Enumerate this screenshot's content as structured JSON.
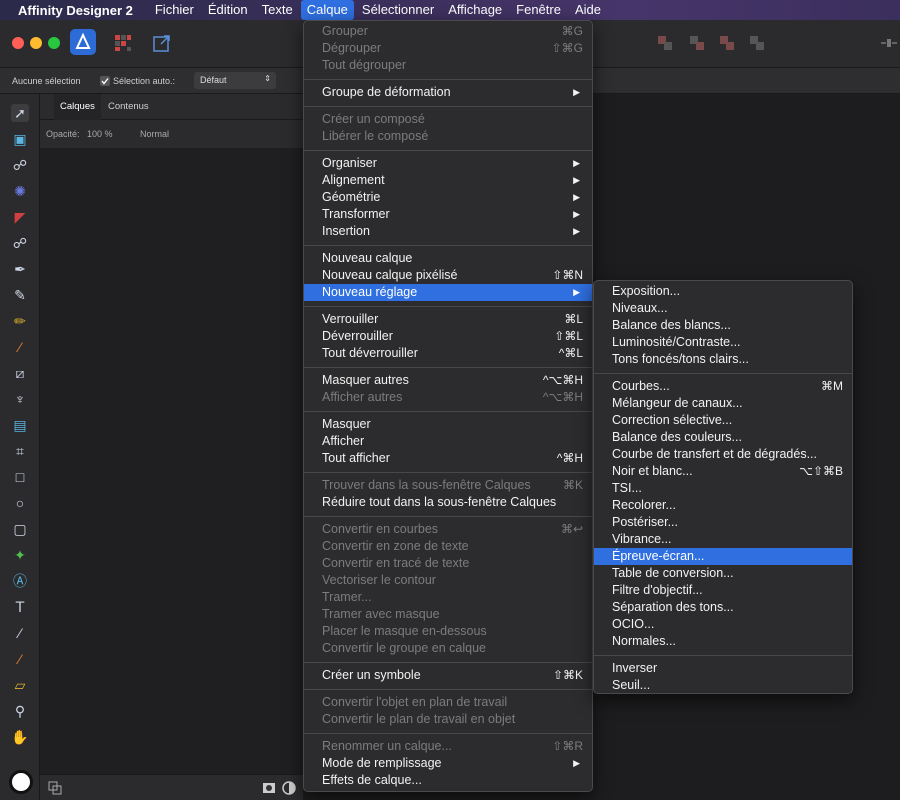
{
  "menubar": {
    "app": "Affinity Designer 2",
    "items": [
      "Fichier",
      "Édition",
      "Texte",
      "Calque",
      "Sélectionner",
      "Affichage",
      "Fenêtre",
      "Aide"
    ],
    "active_index": 3
  },
  "contextbar": {
    "no_selection": "Aucune sélection",
    "auto_select": "Sélection auto.:",
    "default_value": "Défaut"
  },
  "layers_panel": {
    "tabs": [
      "Calques",
      "Contenus"
    ],
    "opacity_label": "Opacité:",
    "opacity_value": "100 %",
    "blend_mode": "Normal"
  },
  "calque_menu": {
    "groups": [
      [
        {
          "label": "Grouper",
          "shortcut": "⌘G",
          "disabled": true
        },
        {
          "label": "Dégrouper",
          "shortcut": "⇧⌘G",
          "disabled": true
        },
        {
          "label": "Tout dégrouper",
          "shortcut": "",
          "disabled": true
        }
      ],
      [
        {
          "label": "Groupe de déformation",
          "submenu": true
        }
      ],
      [
        {
          "label": "Créer un composé",
          "disabled": true
        },
        {
          "label": "Libérer le composé",
          "disabled": true
        }
      ],
      [
        {
          "label": "Organiser",
          "submenu": true
        },
        {
          "label": "Alignement",
          "submenu": true
        },
        {
          "label": "Géométrie",
          "submenu": true
        },
        {
          "label": "Transformer",
          "submenu": true
        },
        {
          "label": "Insertion",
          "submenu": true
        }
      ],
      [
        {
          "label": "Nouveau calque"
        },
        {
          "label": "Nouveau calque pixélisé",
          "shortcut": "⇧⌘N"
        },
        {
          "label": "Nouveau réglage",
          "submenu": true,
          "highlighted": true
        }
      ],
      [
        {
          "label": "Verrouiller",
          "shortcut": "⌘L"
        },
        {
          "label": "Déverrouiller",
          "shortcut": "⇧⌘L"
        },
        {
          "label": "Tout déverrouiller",
          "shortcut": "^⌘L"
        }
      ],
      [
        {
          "label": "Masquer autres",
          "shortcut": "^⌥⌘H"
        },
        {
          "label": "Afficher autres",
          "shortcut": "^⌥⌘H",
          "disabled": true
        }
      ],
      [
        {
          "label": "Masquer"
        },
        {
          "label": "Afficher"
        },
        {
          "label": "Tout afficher",
          "shortcut": "^⌘H"
        }
      ],
      [
        {
          "label": "Trouver dans la sous-fenêtre Calques",
          "shortcut": "⌘K",
          "disabled": true
        },
        {
          "label": "Réduire tout dans la sous-fenêtre Calques"
        }
      ],
      [
        {
          "label": "Convertir en courbes",
          "shortcut": "⌘↩",
          "disabled": true
        },
        {
          "label": "Convertir en zone de texte",
          "disabled": true
        },
        {
          "label": "Convertir en tracé de texte",
          "disabled": true
        },
        {
          "label": "Vectoriser le contour",
          "disabled": true
        },
        {
          "label": "Tramer...",
          "disabled": true
        },
        {
          "label": "Tramer avec masque",
          "disabled": true
        },
        {
          "label": "Placer le masque en-dessous",
          "disabled": true
        },
        {
          "label": "Convertir le groupe en calque",
          "disabled": true
        }
      ],
      [
        {
          "label": "Créer un symbole",
          "shortcut": "⇧⌘K"
        }
      ],
      [
        {
          "label": "Convertir l'objet en plan de travail",
          "disabled": true
        },
        {
          "label": "Convertir le plan de travail en objet",
          "disabled": true
        }
      ],
      [
        {
          "label": "Renommer un calque...",
          "shortcut": "⇧⌘R",
          "disabled": true
        },
        {
          "label": "Mode de remplissage",
          "submenu": true
        },
        {
          "label": "Effets de calque..."
        }
      ]
    ]
  },
  "reglage_submenu": {
    "groups": [
      [
        {
          "label": "Exposition..."
        },
        {
          "label": "Niveaux..."
        },
        {
          "label": "Balance des blancs..."
        },
        {
          "label": "Luminosité/Contraste..."
        },
        {
          "label": "Tons foncés/tons clairs..."
        }
      ],
      [
        {
          "label": "Courbes...",
          "shortcut": "⌘M"
        },
        {
          "label": "Mélangeur de canaux..."
        },
        {
          "label": "Correction sélective..."
        },
        {
          "label": "Balance des couleurs..."
        },
        {
          "label": "Courbe de transfert et de dégradés..."
        },
        {
          "label": "Noir et blanc...",
          "shortcut": "⌥⇧⌘B"
        },
        {
          "label": "TSI..."
        },
        {
          "label": "Recolorer..."
        },
        {
          "label": "Postériser..."
        },
        {
          "label": "Vibrance..."
        },
        {
          "label": "Épreuve-écran...",
          "highlighted": true
        },
        {
          "label": "Table de conversion..."
        },
        {
          "label": "Filtre d'objectif..."
        },
        {
          "label": "Séparation des tons..."
        },
        {
          "label": "OCIO..."
        },
        {
          "label": "Normales..."
        }
      ],
      [
        {
          "label": "Inverser"
        },
        {
          "label": "Seuil..."
        }
      ]
    ]
  }
}
